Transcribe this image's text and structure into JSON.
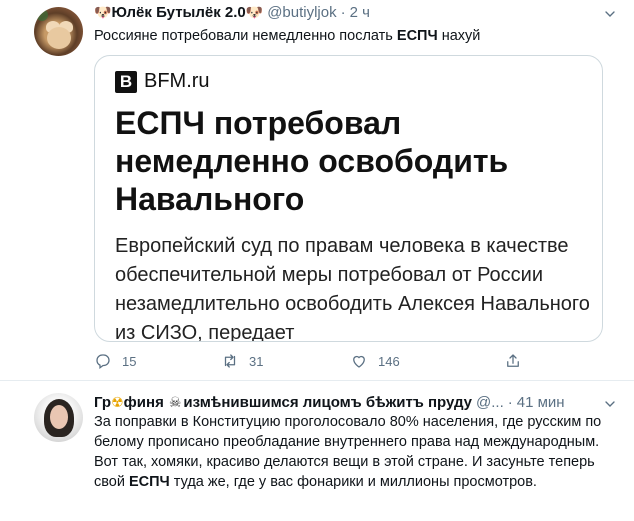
{
  "tweet1": {
    "name": "Юлёк Бутылёк 2.0",
    "handle": "@butiyljok",
    "separator": "·",
    "time": "2 ч",
    "text_plain": "Россияне потребовали немедленно послать ",
    "text_bold": "ЕСПЧ",
    "text_end": " нахуй",
    "card": {
      "logo_letter": "B",
      "logo_text": "BFM.ru",
      "headline": "ЕСПЧ потребовал немедленно освободить Навального",
      "lede": "Европейский суд по правам человека в качестве обеспечительной меры потребовал от России незамедлительно освободить Алексея Навального из СИЗО, передает"
    },
    "actions": {
      "replies": "15",
      "retweets": "31",
      "likes": "146"
    }
  },
  "tweet2": {
    "name_a": "Гр",
    "name_b": "финя",
    "name_c": "измѣнившимся лицомъ бѣжитъ пруду",
    "handle": "@...",
    "separator": "·",
    "time": "41 мин",
    "text_plain": "За поправки в Конституцию проголосовало 80% населения, где русским по белому прописано преобладание внутреннего права над международным. Вот так, хомяки, красиво делаются вещи в этой стране. И засуньте теперь свой ",
    "text_bold": "ЕСПЧ",
    "text_end": " туда же, где у вас фонарики и миллионы просмотров."
  },
  "icons": [
    "dog-emoji",
    "radioactive-emoji",
    "skull-crossbones-emoji",
    "reply-icon",
    "retweet-icon",
    "like-icon",
    "share-icon",
    "caret-down-icon"
  ],
  "colors": {
    "secondary_text": "#5b7083",
    "border": "#cfd9de"
  }
}
